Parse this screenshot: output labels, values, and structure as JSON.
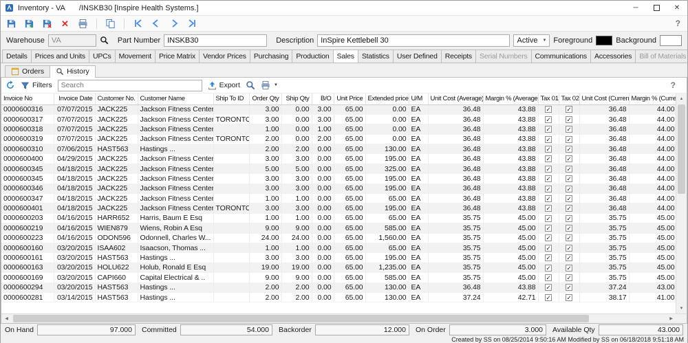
{
  "window": {
    "title": "Inventory - VA",
    "doc": "/INSKB30 [Inspire Health Systems.]"
  },
  "icons": {
    "minimize": "─",
    "close": "✕",
    "dropdown": "▼",
    "up": "▲",
    "down": "▼",
    "left": "◀",
    "right": "▶",
    "check": "✓",
    "help": "?"
  },
  "form": {
    "warehouse": {
      "label": "Warehouse",
      "value": "VA"
    },
    "part_number": {
      "label": "Part Number",
      "value": "INSKB30"
    },
    "description": {
      "label": "Description",
      "value": "InSpire Kettlebell 30"
    },
    "status": {
      "value": "Active"
    },
    "foreground": {
      "label": "Foreground",
      "color": "#000000"
    },
    "background": {
      "label": "Background",
      "color": "#ffffff"
    }
  },
  "tabs": [
    {
      "label": "Details",
      "state": "normal"
    },
    {
      "label": "Prices and Units",
      "state": "normal"
    },
    {
      "label": "UPCs",
      "state": "normal"
    },
    {
      "label": "Movement",
      "state": "normal"
    },
    {
      "label": "Price Matrix",
      "state": "normal"
    },
    {
      "label": "Vendor Prices",
      "state": "normal"
    },
    {
      "label": "Purchasing",
      "state": "normal"
    },
    {
      "label": "Production",
      "state": "normal"
    },
    {
      "label": "Sales",
      "state": "active"
    },
    {
      "label": "Statistics",
      "state": "normal"
    },
    {
      "label": "User Defined",
      "state": "normal"
    },
    {
      "label": "Receipts",
      "state": "normal"
    },
    {
      "label": "Serial Numbers",
      "state": "disabled"
    },
    {
      "label": "Communications",
      "state": "normal"
    },
    {
      "label": "Accessories",
      "state": "normal"
    },
    {
      "label": "Bill of Materials",
      "state": "disabled"
    }
  ],
  "subtabs": [
    {
      "label": "Orders",
      "state": "normal"
    },
    {
      "label": "History",
      "state": "active"
    }
  ],
  "grid_toolbar": {
    "filters": "Filters",
    "search_placeholder": "Search",
    "export": "Export"
  },
  "table": {
    "columns": [
      "Invoice No",
      "Invoice Date",
      "Customer No.",
      "Customer Name",
      "Ship To ID",
      "Order Qty",
      "Ship Qty",
      "B/O",
      "Unit Price",
      "Extended price",
      "U/M",
      "Unit Cost (Average)",
      "Margin % (Average)",
      "Tax 01",
      "Tax 02",
      "Unit Cost (Current)",
      "Margin % (Current)"
    ],
    "rows": [
      [
        "0000600316",
        "07/07/2015",
        "JACK225",
        "Jackson Fitness Center",
        "",
        "3.00",
        "0.00",
        "3.00",
        "65.00",
        "0.00",
        "EA",
        "36.48",
        "43.88",
        true,
        true,
        "36.48",
        "44.00"
      ],
      [
        "0000600317",
        "07/07/2015",
        "JACK225",
        "Jackson Fitness Center",
        "TORONTO",
        "3.00",
        "0.00",
        "3.00",
        "65.00",
        "0.00",
        "EA",
        "36.48",
        "43.88",
        true,
        true,
        "36.48",
        "44.00"
      ],
      [
        "0000600318",
        "07/07/2015",
        "JACK225",
        "Jackson Fitness Center",
        "",
        "1.00",
        "0.00",
        "1.00",
        "65.00",
        "0.00",
        "EA",
        "36.48",
        "43.88",
        true,
        true,
        "36.48",
        "44.00"
      ],
      [
        "0000600319",
        "07/07/2015",
        "JACK225",
        "Jackson Fitness Center",
        "TORONTO",
        "2.00",
        "0.00",
        "2.00",
        "65.00",
        "0.00",
        "EA",
        "36.48",
        "43.88",
        true,
        true,
        "36.48",
        "44.00"
      ],
      [
        "0000600310",
        "07/06/2015",
        "HAST563",
        "Hastings ...",
        "",
        "2.00",
        "2.00",
        "0.00",
        "65.00",
        "130.00",
        "EA",
        "36.48",
        "43.88",
        true,
        true,
        "36.48",
        "44.00"
      ],
      [
        "0000600400",
        "04/29/2015",
        "JACK225",
        "Jackson Fitness Center",
        "",
        "3.00",
        "3.00",
        "0.00",
        "65.00",
        "195.00",
        "EA",
        "36.48",
        "43.88",
        true,
        true,
        "36.48",
        "44.00"
      ],
      [
        "0000600345",
        "04/18/2015",
        "JACK225",
        "Jackson Fitness Center",
        "",
        "5.00",
        "5.00",
        "0.00",
        "65.00",
        "325.00",
        "EA",
        "36.48",
        "43.88",
        true,
        true,
        "36.48",
        "44.00"
      ],
      [
        "0000600345",
        "04/18/2015",
        "JACK225",
        "Jackson Fitness Center",
        "",
        "3.00",
        "3.00",
        "0.00",
        "65.00",
        "195.00",
        "EA",
        "36.48",
        "43.88",
        true,
        true,
        "36.48",
        "44.00"
      ],
      [
        "0000600346",
        "04/18/2015",
        "JACK225",
        "Jackson Fitness Center",
        "",
        "3.00",
        "3.00",
        "0.00",
        "65.00",
        "195.00",
        "EA",
        "36.48",
        "43.88",
        true,
        true,
        "36.48",
        "44.00"
      ],
      [
        "0000600347",
        "04/18/2015",
        "JACK225",
        "Jackson Fitness Center",
        "",
        "1.00",
        "1.00",
        "0.00",
        "65.00",
        "65.00",
        "EA",
        "36.48",
        "43.88",
        true,
        true,
        "36.48",
        "44.00"
      ],
      [
        "0000600401",
        "04/18/2015",
        "JACK225",
        "Jackson Fitness Center",
        "TORONTO",
        "3.00",
        "3.00",
        "0.00",
        "65.00",
        "195.00",
        "EA",
        "36.48",
        "43.88",
        true,
        true,
        "36.48",
        "44.00"
      ],
      [
        "0000600203",
        "04/16/2015",
        "HARR652",
        "Harris, Baum E Esq",
        "",
        "1.00",
        "1.00",
        "0.00",
        "65.00",
        "65.00",
        "EA",
        "35.75",
        "45.00",
        true,
        true,
        "35.75",
        "45.00"
      ],
      [
        "0000600219",
        "04/16/2015",
        "WIEN879",
        "Wiens, Robin A Esq",
        "",
        "9.00",
        "9.00",
        "0.00",
        "65.00",
        "585.00",
        "EA",
        "35.75",
        "45.00",
        true,
        true,
        "35.75",
        "45.00"
      ],
      [
        "0000600223",
        "04/16/2015",
        "ODON596",
        "Odonnell, Charles W...",
        "",
        "24.00",
        "24.00",
        "0.00",
        "65.00",
        "1,560.00",
        "EA",
        "35.75",
        "45.00",
        true,
        true,
        "35.75",
        "45.00"
      ],
      [
        "0000600160",
        "03/20/2015",
        "ISAA602",
        "Isaacson, Thomas ...",
        "",
        "1.00",
        "1.00",
        "0.00",
        "65.00",
        "65.00",
        "EA",
        "35.75",
        "45.00",
        true,
        true,
        "35.75",
        "45.00"
      ],
      [
        "0000600161",
        "03/20/2015",
        "HAST563",
        "Hastings ...",
        "",
        "3.00",
        "3.00",
        "0.00",
        "65.00",
        "195.00",
        "EA",
        "35.75",
        "45.00",
        true,
        true,
        "35.75",
        "45.00"
      ],
      [
        "0000600163",
        "03/20/2015",
        "HOLU622",
        "Holub, Ronald E Esq",
        "",
        "19.00",
        "19.00",
        "0.00",
        "65.00",
        "1,235.00",
        "EA",
        "35.75",
        "45.00",
        true,
        true,
        "35.75",
        "45.00"
      ],
      [
        "0000600169",
        "03/20/2015",
        "CAPI660",
        "Capital Electrical & ..",
        "",
        "9.00",
        "9.00",
        "0.00",
        "65.00",
        "585.00",
        "EA",
        "35.75",
        "45.00",
        true,
        true,
        "35.75",
        "45.00"
      ],
      [
        "0000600294",
        "03/20/2015",
        "HAST563",
        "Hastings ...",
        "",
        "2.00",
        "2.00",
        "0.00",
        "65.00",
        "130.00",
        "EA",
        "36.48",
        "43.88",
        true,
        true,
        "37.24",
        "43.00"
      ],
      [
        "0000600281",
        "03/14/2015",
        "HAST563",
        "Hastings ...",
        "",
        "2.00",
        "2.00",
        "0.00",
        "65.00",
        "130.00",
        "EA",
        "37.24",
        "42.71",
        true,
        true,
        "38.17",
        "41.00"
      ]
    ]
  },
  "footer": {
    "fields": [
      {
        "label": "On Hand",
        "value": "97.000"
      },
      {
        "label": "Committed",
        "value": "54.000"
      },
      {
        "label": "Backorder",
        "value": "12.000"
      },
      {
        "label": "On Order",
        "value": "3.000"
      },
      {
        "label": "Available Qty",
        "value": "43.000"
      }
    ]
  },
  "status_bar": {
    "text": "Created by SS on 08/25/2014 9:50:16 AM  Modified by SS on 06/18/2018 9:51:18 AM"
  }
}
